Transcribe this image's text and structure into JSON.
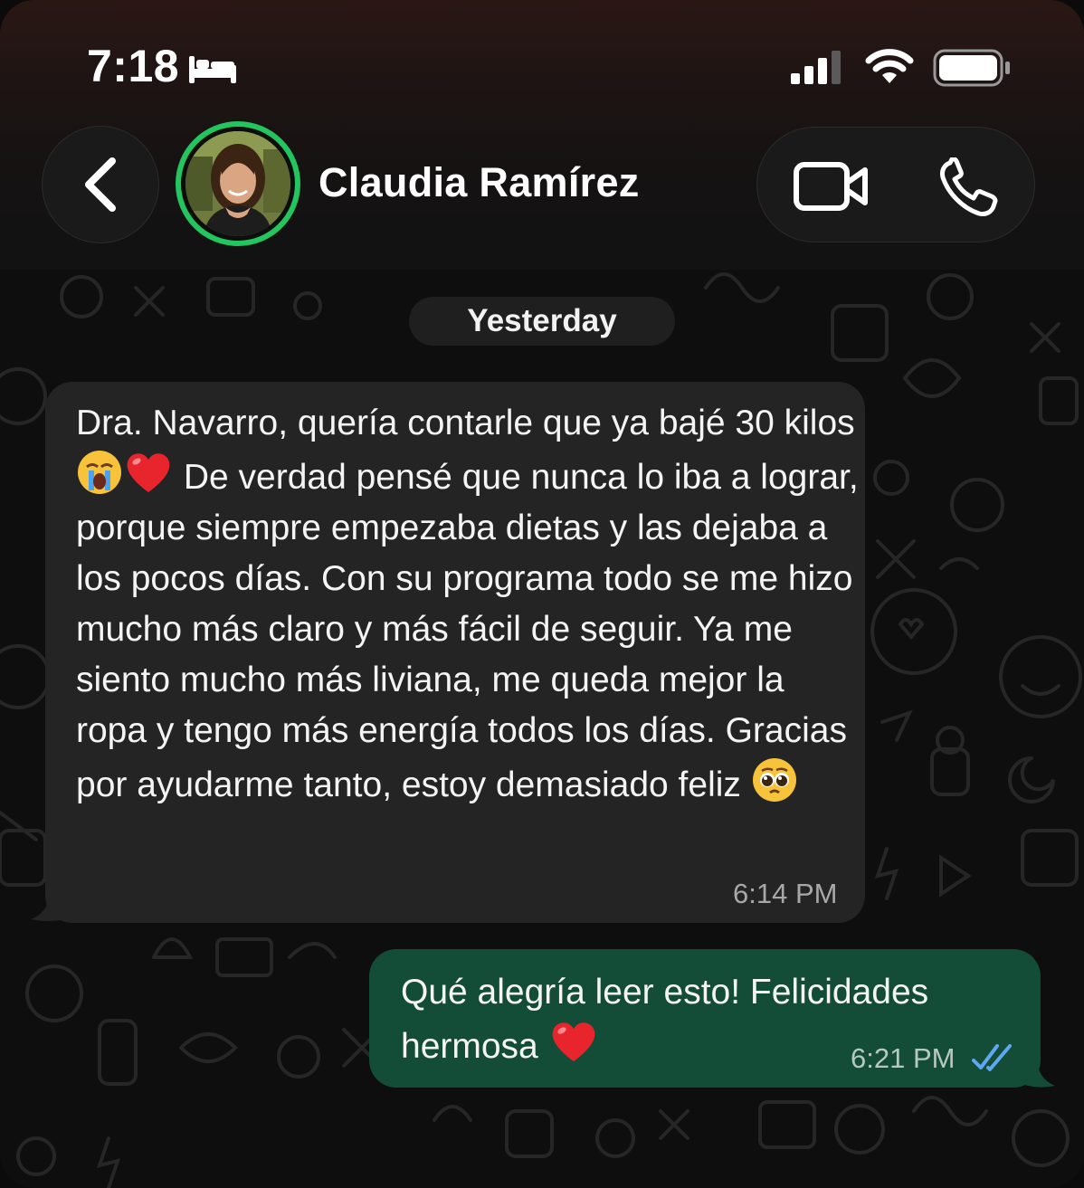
{
  "status_bar": {
    "time": "7:18",
    "focus_icon": "bed-icon",
    "icons": [
      "signal-icon",
      "wifi-icon",
      "battery-icon"
    ]
  },
  "header": {
    "contact_name": "Claudia Ramírez",
    "back_icon": "chevron-left-icon",
    "video_icon": "video-camera-icon",
    "call_icon": "phone-icon",
    "avatar_ring_color": "#22c55e"
  },
  "chat": {
    "date_separator": "Yesterday",
    "messages": [
      {
        "direction": "incoming",
        "segments": [
          "Dra. Navarro, quería contarle que ya bajé 30 kilos ",
          " De verdad pensé que nunca lo iba a lograr, porque siempre empezaba dietas y las dejaba a los pocos días. Con su programa todo se me hizo mucho más claro y más fácil de seguir. Ya me siento mucho más liviana, me queda mejor la ropa y tengo más energía todos los días. Gracias por ayudarme tanto, estoy demasiado feliz "
        ],
        "emojis": [
          "crying-face-emoji",
          "red-heart-emoji",
          "pleading-face-emoji"
        ],
        "time": "6:14 PM"
      },
      {
        "direction": "outgoing",
        "segments": [
          "Qué alegría leer esto! Felicidades hermosa "
        ],
        "emojis": [
          "red-heart-emoji"
        ],
        "time": "6:21 PM",
        "status": "read"
      }
    ]
  },
  "colors": {
    "incoming_bubble": "#242424",
    "outgoing_bubble": "#134d37",
    "read_ticks": "#5fa8f0"
  }
}
